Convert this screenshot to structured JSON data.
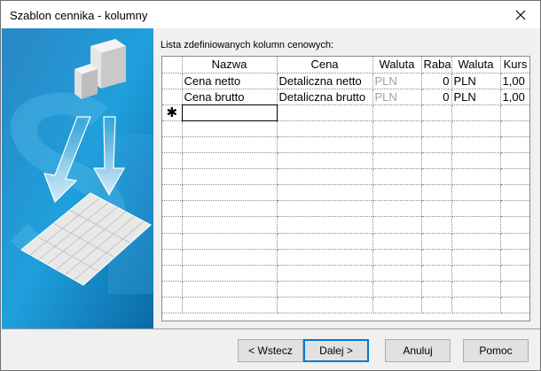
{
  "window": {
    "title": "Szablon cennika - kolumny"
  },
  "grid": {
    "label": "Lista zdefiniowanych kolumn cenowych:",
    "columns": [
      "Nazwa",
      "Cena",
      "Waluta",
      "Raba",
      "Waluta",
      "Kurs"
    ],
    "rows": [
      [
        "Cena netto",
        "Detaliczna netto",
        "PLN",
        "0",
        "PLN",
        "1,00"
      ],
      [
        "Cena brutto",
        "Detaliczna brutto",
        "PLN",
        "0",
        "PLN",
        "1,00"
      ]
    ],
    "new_row_marker": "✱"
  },
  "buttons": {
    "back": "< Wstecz",
    "next": "Dalej >",
    "cancel": "Anuluj",
    "help": "Pomoc"
  },
  "colors": {
    "accent": "#0078d7",
    "art_blue": "#1a9bd7"
  },
  "icons": [
    "close-icon",
    "server-icon",
    "arrow-down-icon",
    "table-sheet-icon"
  ]
}
